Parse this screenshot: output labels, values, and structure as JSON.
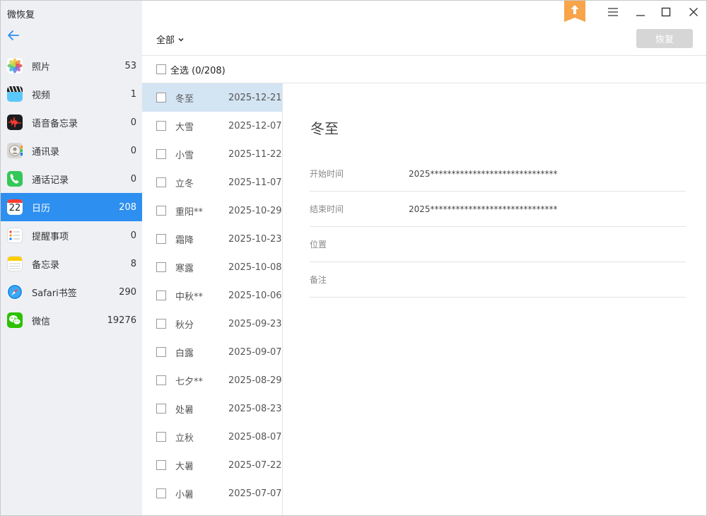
{
  "app": {
    "title": "微恢复"
  },
  "sidebar": {
    "items": [
      {
        "label": "照片",
        "count": "53",
        "icon": "photos-icon"
      },
      {
        "label": "视频",
        "count": "1",
        "icon": "video-clapper-icon"
      },
      {
        "label": "语音备忘录",
        "count": "0",
        "icon": "voice-memo-icon"
      },
      {
        "label": "通讯录",
        "count": "0",
        "icon": "contacts-icon"
      },
      {
        "label": "通话记录",
        "count": "0",
        "icon": "phone-icon"
      },
      {
        "label": "日历",
        "count": "208",
        "icon": "calendar-icon",
        "calendar_day": "22"
      },
      {
        "label": "提醒事项",
        "count": "0",
        "icon": "reminders-icon"
      },
      {
        "label": "备忘录",
        "count": "8",
        "icon": "notes-icon"
      },
      {
        "label": "Safari书签",
        "count": "290",
        "icon": "safari-compass-icon"
      },
      {
        "label": "微信",
        "count": "19276",
        "icon": "wechat-icon"
      }
    ],
    "active_index": 5
  },
  "toolbar": {
    "filter_label": "全部",
    "restore_label": "恢复"
  },
  "select_all": {
    "label": "全选 (0/208)"
  },
  "events": [
    {
      "name": "冬至",
      "date": "2025-12-21"
    },
    {
      "name": "大雪",
      "date": "2025-12-07"
    },
    {
      "name": "小雪",
      "date": "2025-11-22"
    },
    {
      "name": "立冬",
      "date": "2025-11-07"
    },
    {
      "name": "重阳**",
      "date": "2025-10-29"
    },
    {
      "name": "霜降",
      "date": "2025-10-23"
    },
    {
      "name": "寒露",
      "date": "2025-10-08"
    },
    {
      "name": "中秋**",
      "date": "2025-10-06"
    },
    {
      "name": "秋分",
      "date": "2025-09-23"
    },
    {
      "name": "白露",
      "date": "2025-09-07"
    },
    {
      "name": "七夕**",
      "date": "2025-08-29"
    },
    {
      "name": "处暑",
      "date": "2025-08-23"
    },
    {
      "name": "立秋",
      "date": "2025-08-07"
    },
    {
      "name": "大暑",
      "date": "2025-07-22"
    },
    {
      "name": "小暑",
      "date": "2025-07-07"
    }
  ],
  "selected_event_index": 0,
  "detail": {
    "title": "冬至",
    "fields": [
      {
        "label": "开始时间",
        "value": "2025******************************"
      },
      {
        "label": "结束时间",
        "value": "2025******************************"
      },
      {
        "label": "位置",
        "value": ""
      },
      {
        "label": "备注",
        "value": ""
      }
    ]
  },
  "colors": {
    "accent": "#2d8ff0",
    "selected_row": "#d3e4f3",
    "sidebar_bg": "#eef0f4",
    "restore_disabled": "#d6d6d6",
    "badge": "#f7a44a"
  }
}
